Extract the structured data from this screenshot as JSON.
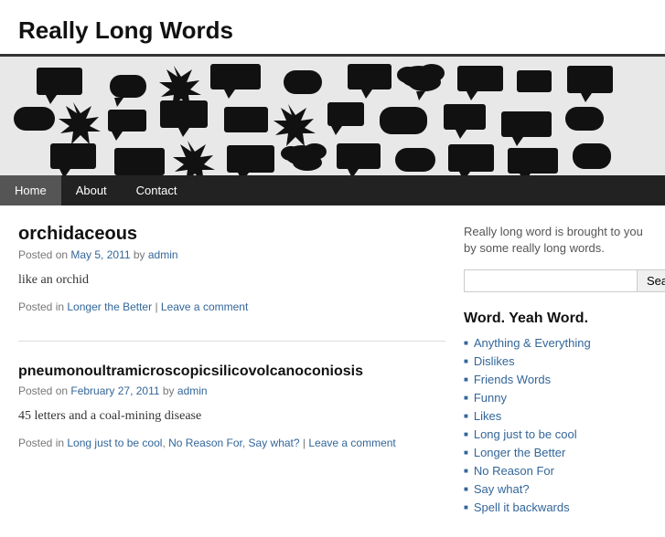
{
  "site": {
    "title": "Really Long Words",
    "tagline": "Really long word is brought to you by some really long words."
  },
  "nav": {
    "items": [
      {
        "label": "Home",
        "href": "#",
        "active": true
      },
      {
        "label": "About",
        "href": "#",
        "active": false
      },
      {
        "label": "Contact",
        "href": "#",
        "active": false
      }
    ]
  },
  "search": {
    "placeholder": "",
    "button_label": "Search"
  },
  "sidebar": {
    "widget_title": "Word. Yeah Word.",
    "links": [
      "Anything & Everything",
      "Dislikes",
      "Friends Words",
      "Funny",
      "Likes",
      "Long just to be cool",
      "Longer the Better",
      "No Reason For",
      "Say what?",
      "Spell it backwards"
    ]
  },
  "posts": [
    {
      "title": "orchidaceous",
      "date": "May 5, 2011",
      "author": "admin",
      "content": "like an orchid",
      "categories": [
        "Longer the Better"
      ],
      "footer_links": [
        "Longer the Better",
        "Leave a comment"
      ]
    },
    {
      "title": "pneumonoultramicroscopicsilicovolcanoconiosis",
      "date": "February 27, 2011",
      "author": "admin",
      "content": "45 letters and a coal-mining disease",
      "categories": [
        "Long just to be cool",
        "No Reason For",
        "Say what?"
      ],
      "footer_links": [
        "Long just to be cool",
        "No Reason For",
        "Say what?",
        "Leave a comment"
      ]
    }
  ]
}
